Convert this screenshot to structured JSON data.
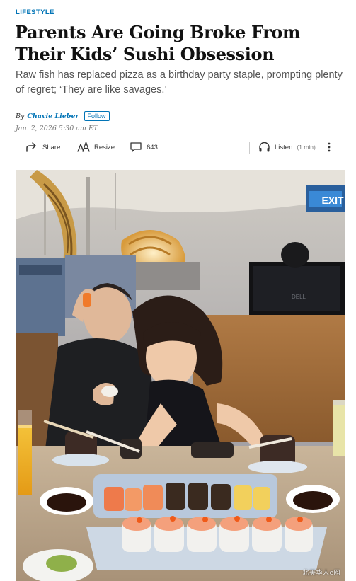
{
  "article": {
    "section": "LIFESTYLE",
    "headline": "Parents Are Going Broke From Their Kids’ Sushi Obsession",
    "dek": "Raw fish has replaced pizza as a birthday party staple, prompting plenty of regret; ‘They are like savages.’",
    "byline_prefix": "By",
    "author": "Chavie Lieber",
    "follow_label": "Follow",
    "date": "Jan. 2, 2026 5:30 am ET"
  },
  "toolbar": {
    "share_label": "Share",
    "resize_label": "Resize",
    "comment_count": "643",
    "listen_label": "Listen",
    "listen_duration": "(1 min)"
  },
  "photo": {
    "exit_sign": "EXIT",
    "monitor_brand": "DELL"
  },
  "watermark": "北美华人e网",
  "icons": [
    "share-icon",
    "resize-icon",
    "comment-icon",
    "headphones-icon",
    "more-icon"
  ],
  "colors": {
    "accent": "#0274b6",
    "headline": "#111111",
    "dek": "#555555"
  }
}
